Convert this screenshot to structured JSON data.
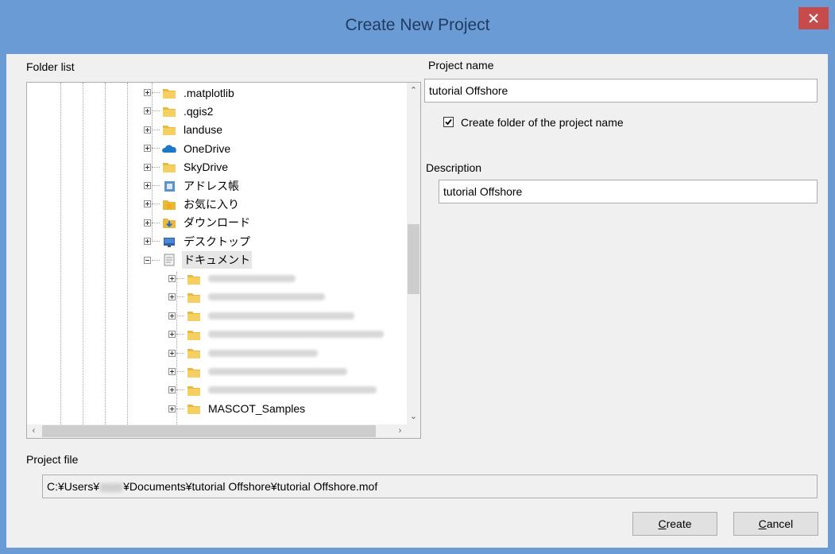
{
  "window": {
    "title": "Create New Project",
    "close_icon": "close-icon"
  },
  "folder_list": {
    "label": "Folder list",
    "items": [
      {
        "label": ".matplotlib",
        "icon": "folder-icon",
        "expanded": false
      },
      {
        "label": ".qgis2",
        "icon": "folder-icon",
        "expanded": false
      },
      {
        "label": "landuse",
        "icon": "folder-icon",
        "expanded": false
      },
      {
        "label": "OneDrive",
        "icon": "onedrive-icon",
        "expanded": false
      },
      {
        "label": "SkyDrive",
        "icon": "folder-icon",
        "expanded": false
      },
      {
        "label": "アドレス帳",
        "icon": "contacts-icon",
        "expanded": false
      },
      {
        "label": "お気に入り",
        "icon": "favorites-icon",
        "expanded": false
      },
      {
        "label": "ダウンロード",
        "icon": "downloads-icon",
        "expanded": false
      },
      {
        "label": "デスクトップ",
        "icon": "desktop-icon",
        "expanded": false
      },
      {
        "label": "ドキュメント",
        "icon": "documents-icon",
        "expanded": true,
        "selected": true
      }
    ],
    "children": [
      {
        "label": "",
        "icon": "folder-icon",
        "blurred": true
      },
      {
        "label": "",
        "icon": "folder-icon",
        "blurred": true
      },
      {
        "label": "",
        "icon": "folder-icon",
        "blurred": true
      },
      {
        "label": "",
        "icon": "folder-icon",
        "blurred": true
      },
      {
        "label": "",
        "icon": "folder-icon",
        "blurred": true
      },
      {
        "label": "",
        "icon": "folder-icon",
        "blurred": true
      },
      {
        "label": "",
        "icon": "folder-icon",
        "blurred": true
      },
      {
        "label": "MASCOT_Samples",
        "icon": "folder-icon",
        "blurred": false
      }
    ]
  },
  "project_name": {
    "label": "Project name",
    "value": "tutorial Offshore"
  },
  "create_folder": {
    "label": "Create folder of the project name",
    "checked": true
  },
  "description": {
    "label": "Description",
    "value": "tutorial Offshore"
  },
  "project_file": {
    "label": "Project file",
    "prefix": "C:¥Users¥",
    "suffix": "¥Documents¥tutorial Offshore¥tutorial Offshore.mof"
  },
  "buttons": {
    "create_mnemonic": "C",
    "create_rest": "reate",
    "cancel_mnemonic": "C",
    "cancel_rest": "ancel"
  },
  "colors": {
    "titlebar": "#6b9bd4",
    "close_button": "#c74b4b",
    "dialog_background": "#f0f0f0"
  }
}
